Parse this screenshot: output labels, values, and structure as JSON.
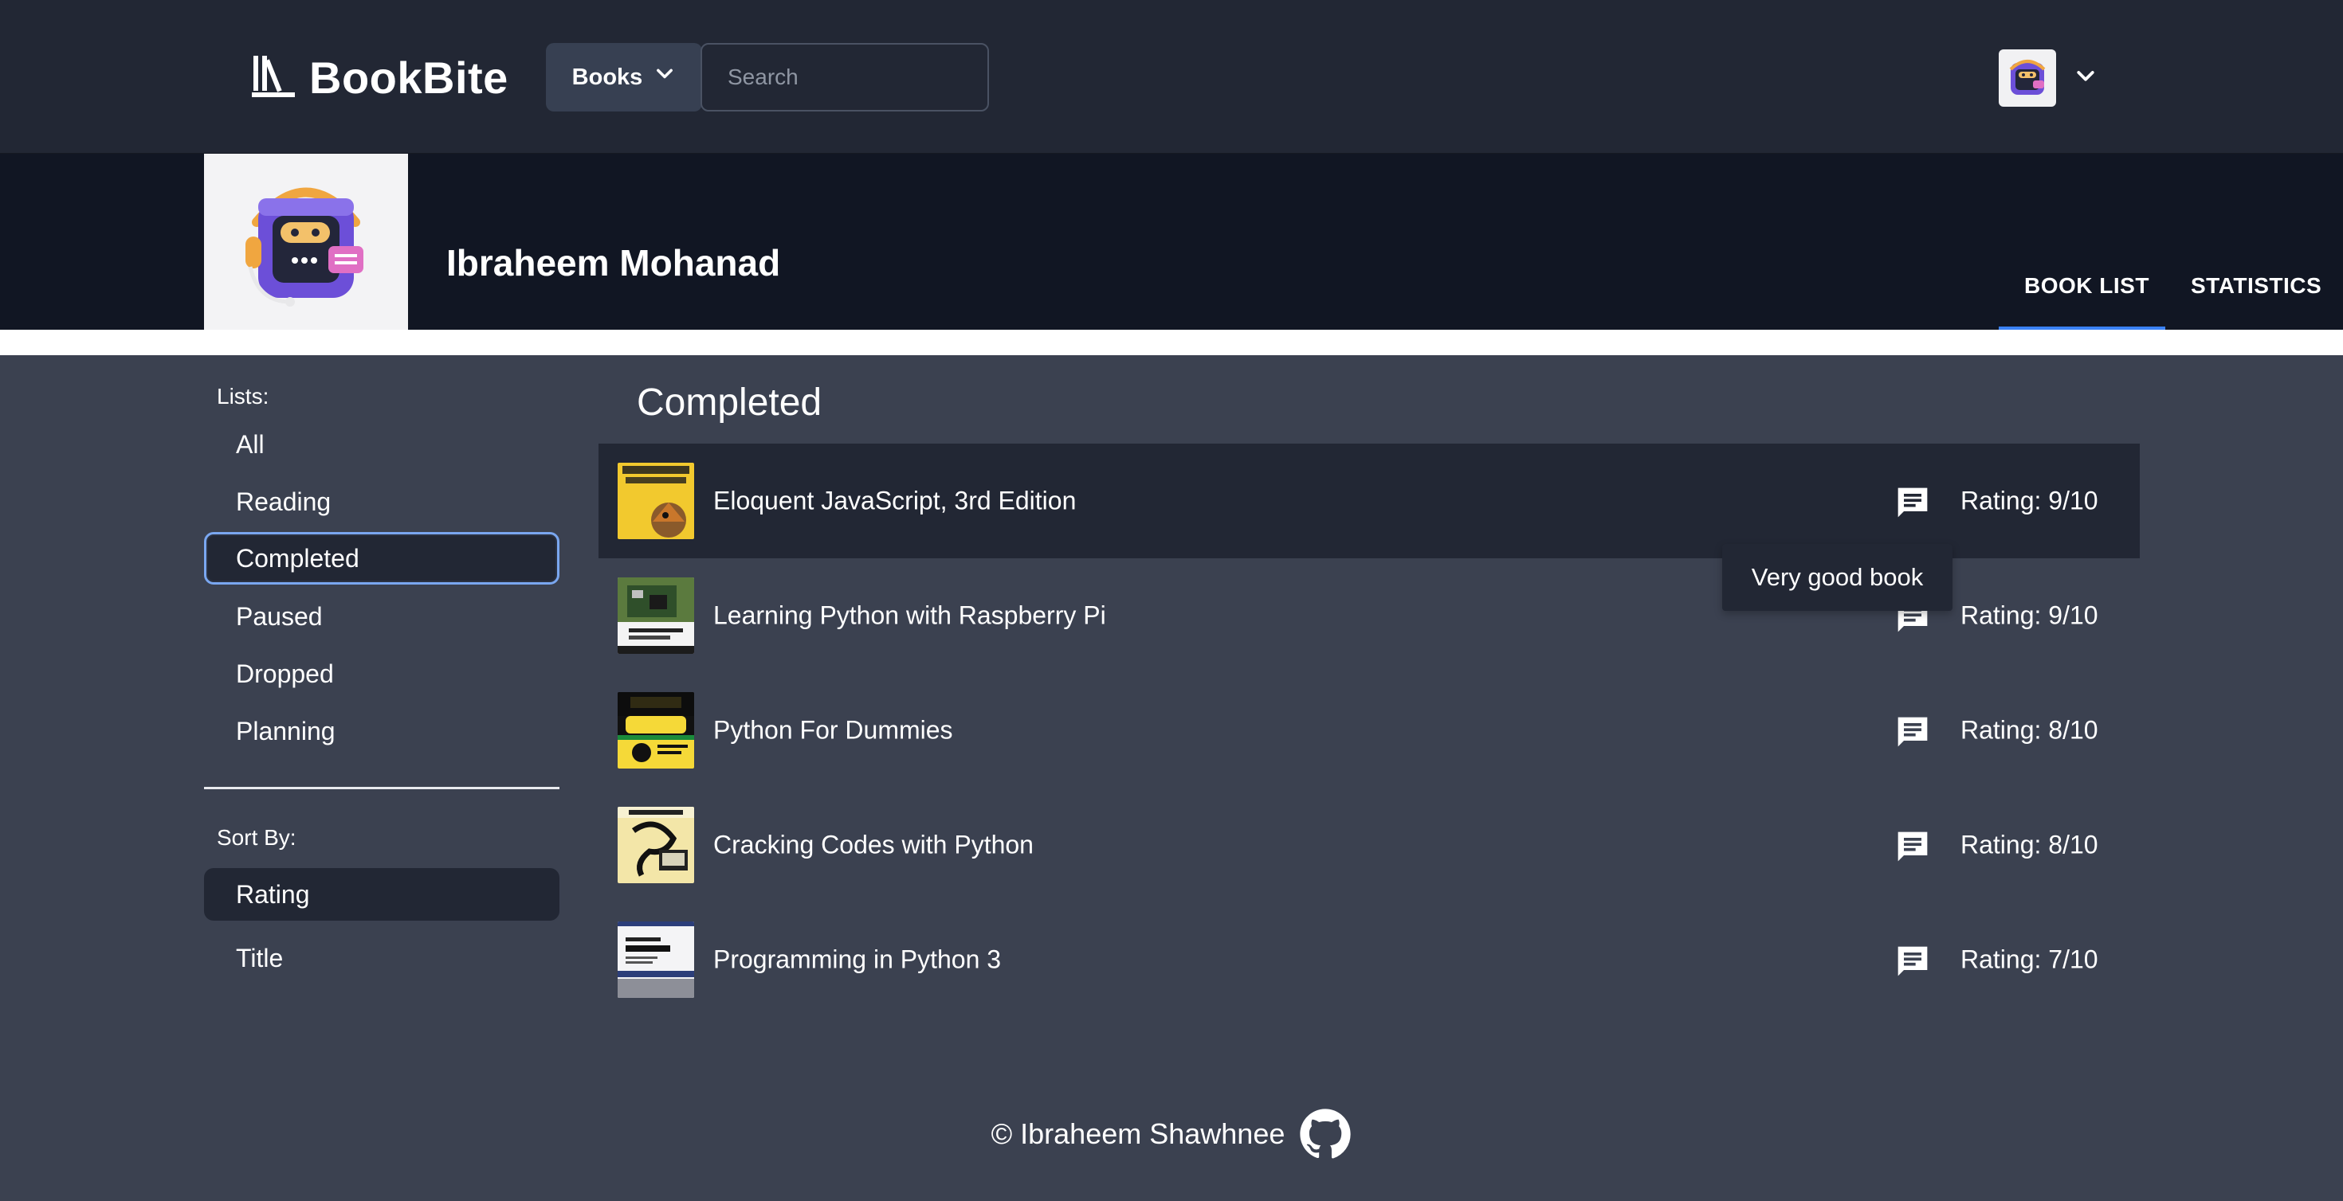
{
  "app": {
    "name": "BookBite",
    "icon": "library-books-icon"
  },
  "nav": {
    "books_label": "Books",
    "search_placeholder": "Search",
    "user_avatar_icon": "robot-avatar-icon"
  },
  "profile": {
    "name": "Ibraheem Mohanad",
    "tabs": [
      {
        "label": "BOOK LIST",
        "active": true
      },
      {
        "label": "STATISTICS",
        "active": false
      }
    ],
    "active_tab_color": "#3b82f6"
  },
  "sidebar": {
    "lists_heading": "Lists:",
    "lists": [
      {
        "label": "All",
        "active": false
      },
      {
        "label": "Reading",
        "active": false
      },
      {
        "label": "Completed",
        "active": true
      },
      {
        "label": "Paused",
        "active": false
      },
      {
        "label": "Dropped",
        "active": false
      },
      {
        "label": "Planning",
        "active": false
      }
    ],
    "sort_heading": "Sort By:",
    "sort_options": [
      {
        "label": "Rating",
        "active": true
      },
      {
        "label": "Title",
        "active": false
      }
    ]
  },
  "main": {
    "section_title": "Completed",
    "books": [
      {
        "title": "Eloquent JavaScript, 3rd Edition",
        "rating": "Rating: 9/10",
        "highlighted": true
      },
      {
        "title": "Learning Python with Raspberry Pi",
        "rating": "Rating: 9/10",
        "highlighted": false
      },
      {
        "title": "Python For Dummies",
        "rating": "Rating: 8/10",
        "highlighted": false
      },
      {
        "title": "Cracking Codes with Python",
        "rating": "Rating: 8/10",
        "highlighted": false
      },
      {
        "title": "Programming in Python 3",
        "rating": "Rating: 7/10",
        "highlighted": false
      }
    ],
    "tooltip": "Very good book"
  },
  "footer": {
    "text": "© Ibraheem Shawhnee",
    "icon": "github-icon"
  },
  "colors": {
    "page_bg": "#3b4150",
    "nav_bg": "#222734",
    "profile_bg": "#111623",
    "accent": "#3b82f6",
    "active_outline": "#7aa7f0"
  }
}
